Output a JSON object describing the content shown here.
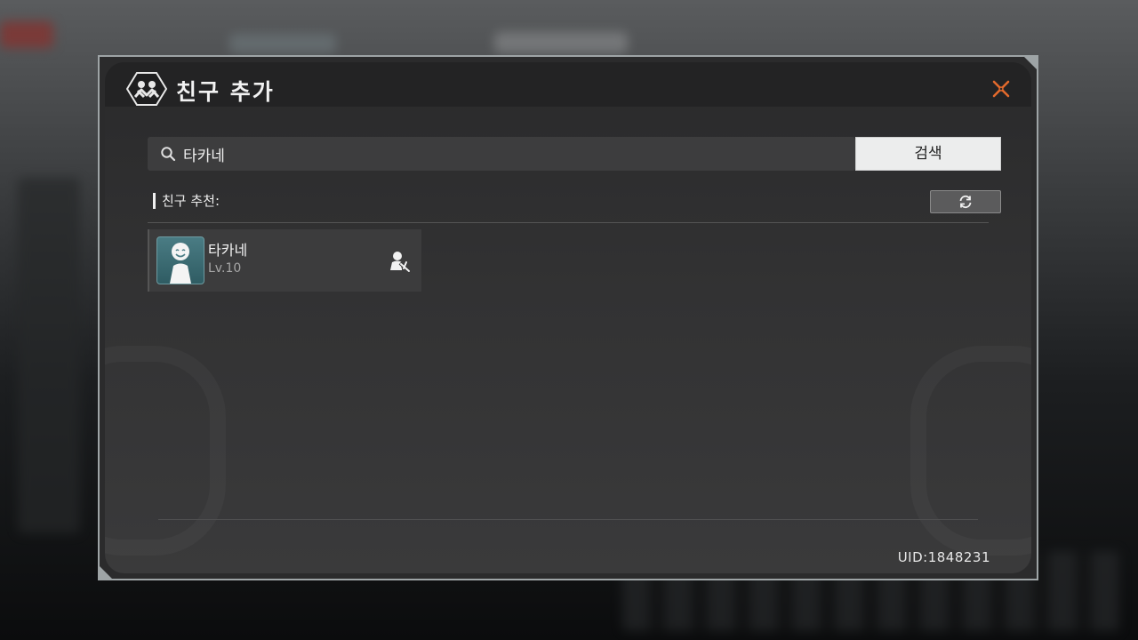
{
  "dialog": {
    "title": "친구 추가",
    "accent_color": "#e36a2c"
  },
  "search": {
    "value": "타카네",
    "placeholder": "",
    "button_label": "검색"
  },
  "recommend": {
    "label": "친구 추천:"
  },
  "friends": [
    {
      "name": "타카네",
      "level": "Lv.10"
    }
  ],
  "footer": {
    "uid": "UID:1848231"
  },
  "icons": {
    "emblem": "friends-emblem-icon",
    "close": "close-icon",
    "search": "search-icon",
    "refresh": "refresh-icon",
    "add_friend": "add-friend-icon"
  }
}
